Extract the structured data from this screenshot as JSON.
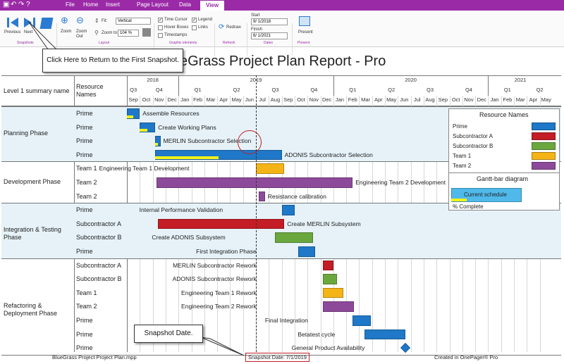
{
  "menu": {
    "tabs": [
      "File",
      "Home",
      "Insert",
      "Page Layout",
      "Data",
      "View"
    ],
    "active": "View"
  },
  "ribbon": {
    "snapshots": {
      "previous": "Previous",
      "next": "Next",
      "group": "Snapshots"
    },
    "layout": {
      "zoom": "Zoom",
      "zoom_out": "Zoom Out",
      "fit_label": "Fit:",
      "fit_value": "Vertical",
      "zoom_to_label": "Zoom to:",
      "zoom_to_value": "104 %",
      "group": "Layout"
    },
    "graphic": {
      "time_cursor": "Time Cursor",
      "hover_boxes": "Hover Boxes",
      "timestamps": "Timestamps",
      "legend": "Legend",
      "links": "Links",
      "group": "Graphic elements"
    },
    "refresh": {
      "redraw": "Redraw",
      "group": "Refresh"
    },
    "dates": {
      "start_label": "Start",
      "start": "9/ 1/2018",
      "finish_label": "Finish",
      "finish": "6/ 1/2021",
      "group": "Dates"
    },
    "present": {
      "label": "Present",
      "group": "Present"
    }
  },
  "callouts": {
    "first_snapshot": "Click Here to Return to the First Snapshot.",
    "snapshot_date": "Snapshot Date."
  },
  "report": {
    "title_visible": "eGrass Project Plan Report - Pro",
    "col1_header": "Level 1 summary name",
    "col2_header": "Resource Names",
    "years": [
      "2018",
      "2019",
      "2020",
      "2021"
    ],
    "quarters": [
      "Q3",
      "Q4",
      "Q1",
      "Q2",
      "Q3",
      "Q4",
      "Q1",
      "Q2",
      "Q3",
      "Q4",
      "Q1",
      "Q2"
    ],
    "months": [
      "Sep",
      "Oct",
      "Nov",
      "Dec",
      "Jan",
      "Feb",
      "Mar",
      "Apr",
      "May",
      "Jun",
      "Jul",
      "Aug",
      "Sep",
      "Oct",
      "Nov",
      "Dec",
      "Jan",
      "Feb",
      "Mar",
      "Apr",
      "May",
      "Jun",
      "Jul",
      "Aug",
      "Sep",
      "Oct",
      "Nov",
      "Dec",
      "Jan",
      "Feb",
      "Mar",
      "Apr",
      "May"
    ],
    "footer_left": "BlueGrass Project Project Plan.mpp",
    "footer_center": "Snapshot Date: 7/1/2019",
    "footer_right": "Created in OnePager® Pro"
  },
  "colors": {
    "Prime": "#1f78c8",
    "Subcontractor A": "#c41d25",
    "Subcontractor B": "#6aa83e",
    "Team 1": "#f5b416",
    "Team 2": "#8e4a9a",
    "progress": "#f2f21a",
    "band": "#e6f2f8",
    "menu": "#9b2aa7"
  },
  "groups": [
    {
      "name": "Planning Phase",
      "rows": [
        {
          "resource": "Prime",
          "task": "Assemble Resources",
          "progress": 0.5
        },
        {
          "resource": "Prime",
          "task": "Create Working Plans",
          "progress": 0.5
        },
        {
          "resource": "Prime",
          "task": "MERLIN Subcontractor Selection",
          "progress": 0.5
        },
        {
          "resource": "Prime",
          "task": "ADONIS Subcontractor Selection",
          "progress": 0.5
        }
      ]
    },
    {
      "name": "Development Phase",
      "rows": [
        {
          "resource": "Team 1",
          "task": "Engineering Team 1 Development",
          "progress": 0
        },
        {
          "resource": "Team 2",
          "task": "Engineering Team 2 Development",
          "progress": 0
        },
        {
          "resource": "Team 2",
          "task": "Resistance calibration",
          "progress": 0
        }
      ]
    },
    {
      "name": "Integration & Testing Phase",
      "rows": [
        {
          "resource": "Prime",
          "task": "Internal Performance Validation",
          "progress": 0
        },
        {
          "resource": "Subcontractor A",
          "task": "Create MERLIN Subsystem",
          "progress": 0
        },
        {
          "resource": "Subcontractor B",
          "task": "Create ADONIS Subsystem",
          "progress": 0
        },
        {
          "resource": "Prime",
          "task": "First Integration Phase",
          "progress": 0
        }
      ]
    },
    {
      "name": "Refactoring & Deployment Phase",
      "rows": [
        {
          "resource": "Subcontractor A",
          "task": "MERLIN Subcontractor Rework",
          "progress": 0
        },
        {
          "resource": "Subcontractor B",
          "task": "ADONIS Subcontractor Rework",
          "progress": 0
        },
        {
          "resource": "Team 1",
          "task": "Engineering Team 1 Rework",
          "progress": 0
        },
        {
          "resource": "Team 2",
          "task": "Engineering Team 2 Rework",
          "progress": 0
        },
        {
          "resource": "Prime",
          "task": "Final Integration",
          "progress": 0
        },
        {
          "resource": "Prime",
          "task": "Betatest cycle",
          "progress": 0
        },
        {
          "resource": "Prime",
          "task": "General Product Availability",
          "progress": 0
        }
      ]
    }
  ],
  "legend": {
    "title": "Resource Names",
    "items": [
      "Prime",
      "Subcontractor A",
      "Subcontractor B",
      "Team 1",
      "Team 2"
    ],
    "gantt_title": "Gantt-bar diagram",
    "current_schedule": "Current schedule",
    "percent_complete": "% Complete"
  }
}
